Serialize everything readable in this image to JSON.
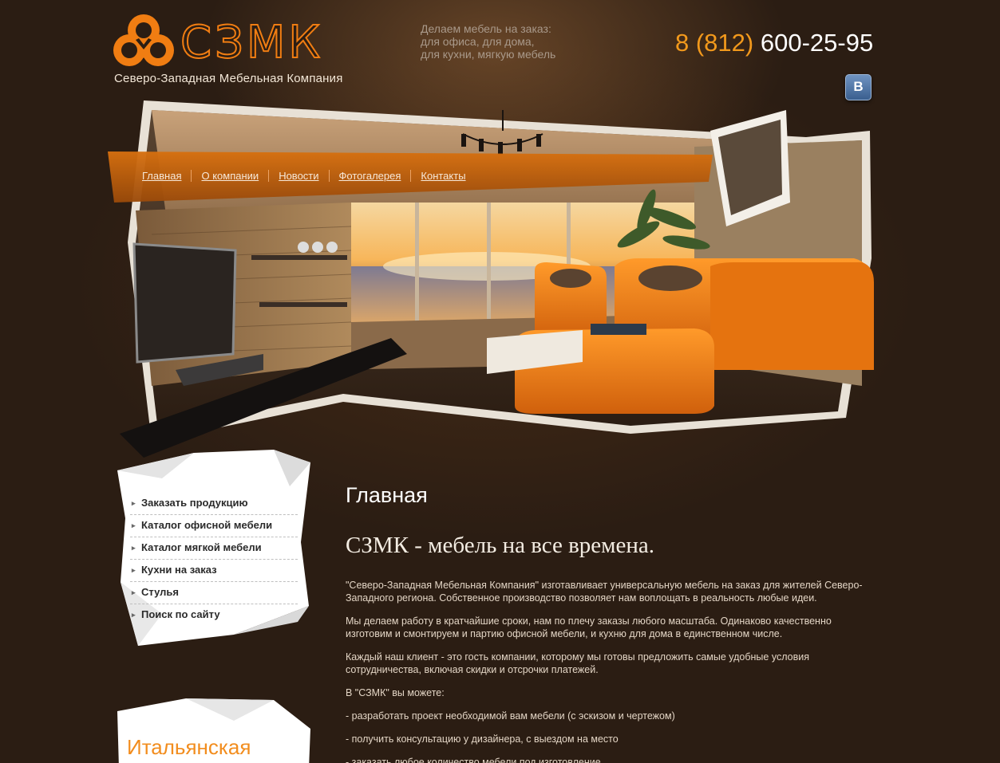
{
  "header": {
    "logo_text": "СЗМК",
    "company_name": "Северо-Западная Мебельная Компания",
    "tagline": [
      "Делаем мебель на заказ:",
      "для офиса, для дома,",
      "для кухни, мягкую мебель"
    ],
    "phone_code": "8 (812)",
    "phone_number": "600-25-95",
    "vk_label": "B"
  },
  "nav": {
    "items": [
      "Главная",
      "О компании",
      "Новости",
      "Фотогалерея",
      "Контакты"
    ]
  },
  "sidebar": {
    "menu": [
      "Заказать продукцию",
      "Каталог офисной мебели",
      "Каталог мягкой мебели",
      "Кухни на заказ",
      "Стулья",
      "Поиск по сайту"
    ],
    "promo_title": "Итальянская"
  },
  "main": {
    "page_title": "Главная",
    "slogan": "СЗМК - мебель на все времена.",
    "paragraphs": [
      "\"Северо-Западная Мебельная Компания\" изготавливает универсальную мебель на заказ для жителей Северо-Западного региона. Собственное производство позволяет нам воплощать в реальность любые идеи.",
      "Мы делаем работу в кратчайшие сроки, нам по плечу заказы любого масштаба. Одинаково качественно изготовим и смонтируем и партию офисной мебели, и кухню для дома в единственном числе.",
      "Каждый наш клиент - это гость компании, которому мы готовы предложить самые удобные условия сотрудничества, включая скидки и отсрочки платежей.",
      "В \"СЗМК\" вы можете:",
      "- разработать проект необходимой вам мебели (с эскизом и чертежом)",
      "- получить консультацию у дизайнера, с выездом на место",
      "- заказать любое количество мебели под изготовление"
    ]
  },
  "colors": {
    "accent": "#f07d12",
    "background": "#2b1d13",
    "phone_code": "#f2991c"
  }
}
